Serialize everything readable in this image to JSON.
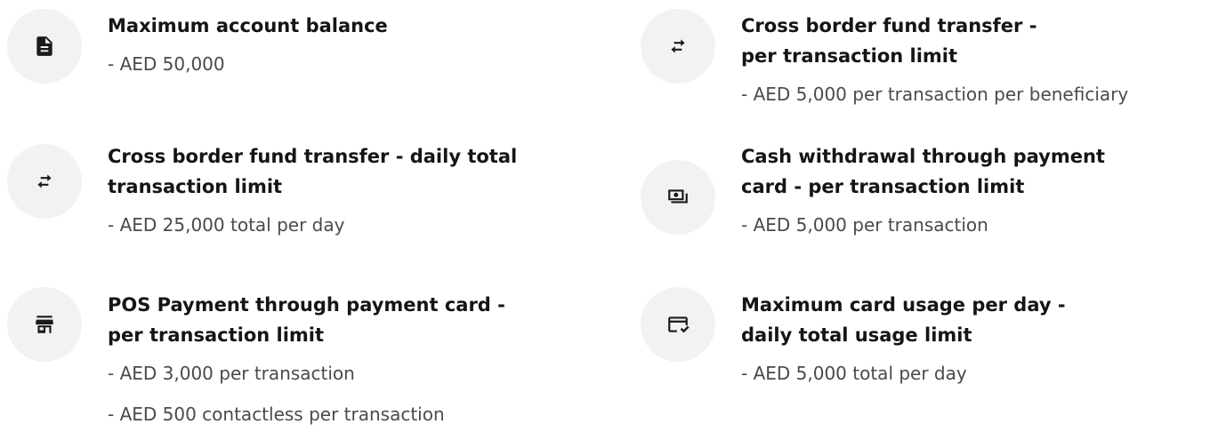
{
  "limits": {
    "left": [
      {
        "icon": "document-icon",
        "title_lines": [
          "Maximum account balance"
        ],
        "details": [
          "- AED 50,000"
        ]
      },
      {
        "icon": "transfer-arrows-icon",
        "title_lines": [
          "Cross border fund transfer - daily total",
          "transaction limit"
        ],
        "details": [
          "- AED 25,000 total per day"
        ]
      },
      {
        "icon": "storefront-icon",
        "title_lines": [
          "POS Payment through payment card -",
          "per transaction limit"
        ],
        "details": [
          "- AED 3,000 per transaction",
          "- AED 500 contactless per transaction"
        ]
      }
    ],
    "right": [
      {
        "icon": "transfer-arrows-icon",
        "title_lines": [
          "Cross border fund transfer -",
          "per transaction limit"
        ],
        "details": [
          "- AED 5,000 per transaction per beneficiary"
        ]
      },
      {
        "icon": "cash-icon",
        "title_lines": [
          "Cash withdrawal through payment",
          "card - per transaction limit"
        ],
        "details": [
          "- AED 5,000 per transaction"
        ]
      },
      {
        "icon": "credit-card-check-icon",
        "title_lines": [
          "Maximum card usage per day -",
          "daily total usage limit"
        ],
        "details": [
          "- AED 5,000 total per day"
        ]
      }
    ]
  },
  "colors": {
    "icon_bg": "#f2f2f2",
    "title": "#151515",
    "detail": "#4a4a4a"
  }
}
